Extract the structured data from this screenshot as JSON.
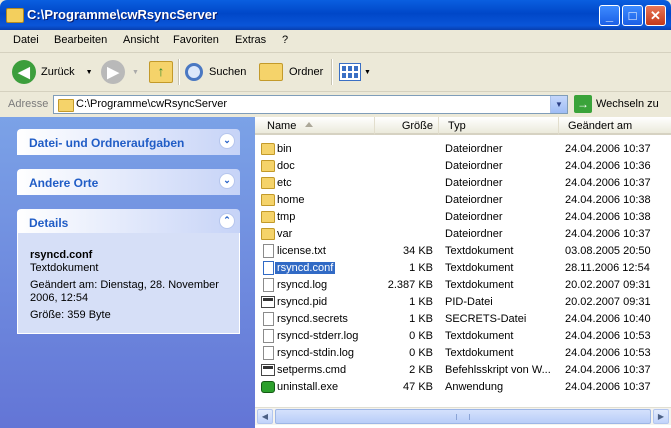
{
  "window": {
    "title": "C:\\Programme\\cwRsyncServer",
    "min_glyph": "_",
    "max_glyph": "□",
    "close_glyph": "✕"
  },
  "menu": [
    "Datei",
    "Bearbeiten",
    "Ansicht",
    "Favoriten",
    "Extras",
    "?"
  ],
  "toolbar": {
    "back_label": "Zurück",
    "search_label": "Suchen",
    "folders_label": "Ordner"
  },
  "address": {
    "label": "Adresse",
    "value": "C:\\Programme\\cwRsyncServer",
    "go_label": "Wechseln zu"
  },
  "tasks": {
    "file_tasks_title": "Datei- und Ordneraufgaben",
    "other_places_title": "Andere Orte",
    "details_title": "Details",
    "details": {
      "name": "rsyncd.conf",
      "type": "Textdokument",
      "modified_line1": "Geändert am: Dienstag, 28. November",
      "modified_line2": "2006, 12:54",
      "size": "Größe: 359 Byte"
    }
  },
  "columns": {
    "name": "Name",
    "size": "Größe",
    "type": "Typ",
    "modified": "Geändert am"
  },
  "files": [
    {
      "name": "bin",
      "size": "",
      "type": "Dateiordner",
      "modified": "24.04.2006 10:37",
      "kind": "folder"
    },
    {
      "name": "doc",
      "size": "",
      "type": "Dateiordner",
      "modified": "24.04.2006 10:36",
      "kind": "folder"
    },
    {
      "name": "etc",
      "size": "",
      "type": "Dateiordner",
      "modified": "24.04.2006 10:37",
      "kind": "folder"
    },
    {
      "name": "home",
      "size": "",
      "type": "Dateiordner",
      "modified": "24.04.2006 10:38",
      "kind": "folder"
    },
    {
      "name": "tmp",
      "size": "",
      "type": "Dateiordner",
      "modified": "24.04.2006 10:38",
      "kind": "folder"
    },
    {
      "name": "var",
      "size": "",
      "type": "Dateiordner",
      "modified": "24.04.2006 10:37",
      "kind": "folder"
    },
    {
      "name": "license.txt",
      "size": "34 KB",
      "type": "Textdokument",
      "modified": "03.08.2005 20:50",
      "kind": "file"
    },
    {
      "name": "rsyncd.conf",
      "size": "1 KB",
      "type": "Textdokument",
      "modified": "28.11.2006 12:54",
      "kind": "file",
      "selected": true
    },
    {
      "name": "rsyncd.log",
      "size": "2.387 KB",
      "type": "Textdokument",
      "modified": "20.02.2007 09:31",
      "kind": "file"
    },
    {
      "name": "rsyncd.pid",
      "size": "1 KB",
      "type": "PID-Datei",
      "modified": "20.02.2007 09:31",
      "kind": "pid"
    },
    {
      "name": "rsyncd.secrets",
      "size": "1 KB",
      "type": "SECRETS-Datei",
      "modified": "24.04.2006 10:40",
      "kind": "file"
    },
    {
      "name": "rsyncd-stderr.log",
      "size": "0 KB",
      "type": "Textdokument",
      "modified": "24.04.2006 10:53",
      "kind": "file"
    },
    {
      "name": "rsyncd-stdin.log",
      "size": "0 KB",
      "type": "Textdokument",
      "modified": "24.04.2006 10:53",
      "kind": "file"
    },
    {
      "name": "setperms.cmd",
      "size": "2 KB",
      "type": "Befehlsskript von W...",
      "modified": "24.04.2006 10:37",
      "kind": "cmd"
    },
    {
      "name": "uninstall.exe",
      "size": "47 KB",
      "type": "Anwendung",
      "modified": "24.04.2006 10:37",
      "kind": "exe"
    }
  ]
}
